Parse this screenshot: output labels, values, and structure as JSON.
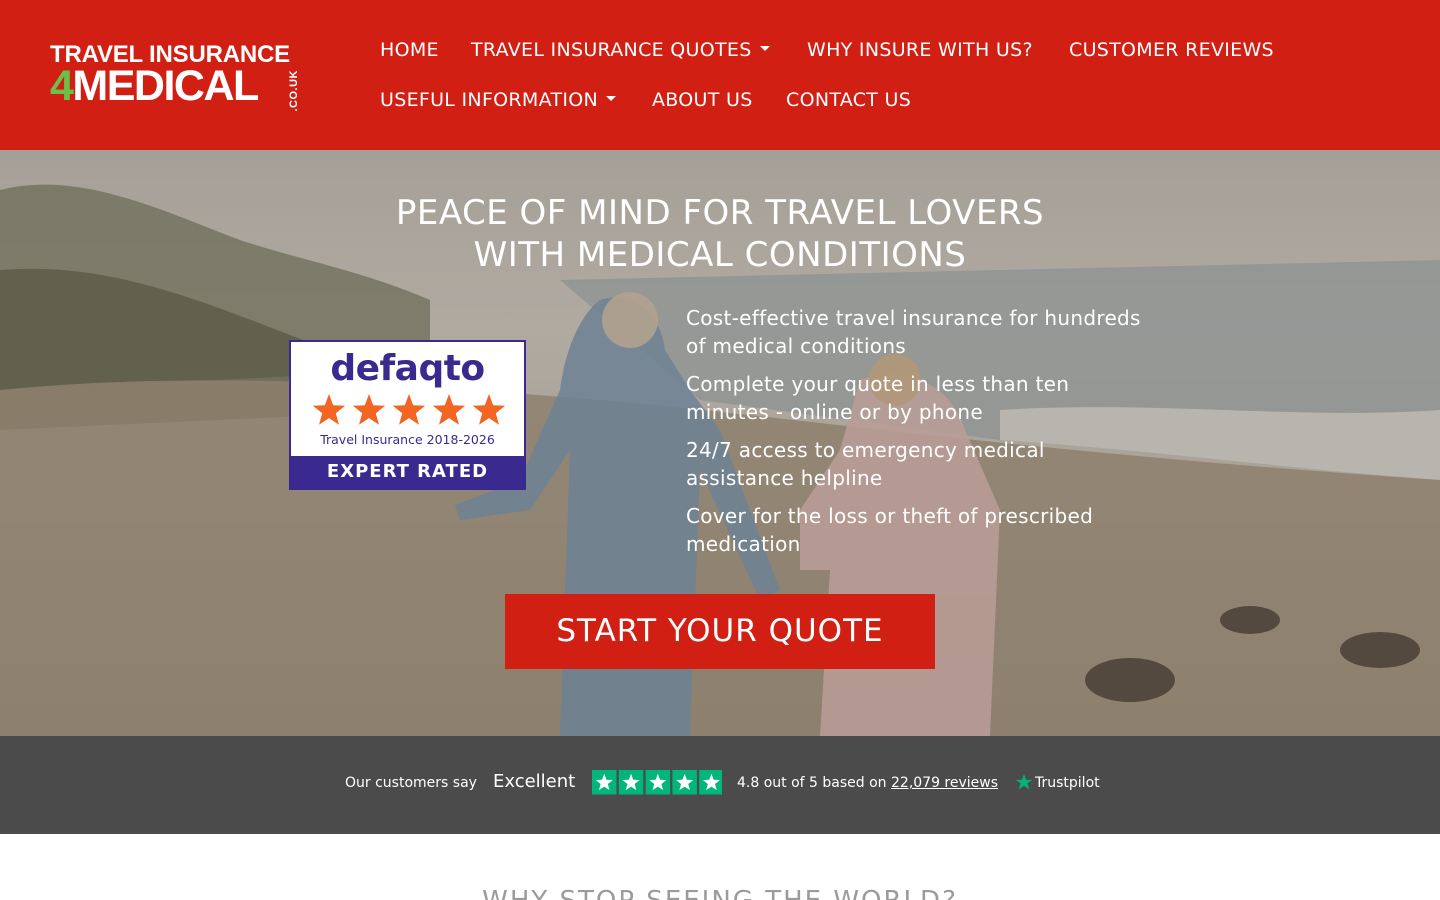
{
  "logo": {
    "line1": "TRAVEL INSURANCE",
    "line2_num": "4",
    "line2_word": "MEDICAL",
    "suffix": ".CO.UK"
  },
  "nav": {
    "home": "HOME",
    "quotes": "TRAVEL INSURANCE QUOTES",
    "why": "WHY INSURE WITH US?",
    "reviews": "CUSTOMER REVIEWS",
    "useful": "USEFUL INFORMATION",
    "about": "ABOUT US",
    "contact": "CONTACT US"
  },
  "hero": {
    "title_line1": "PEACE OF MIND FOR TRAVEL LOVERS",
    "title_line2": "WITH MEDICAL CONDITIONS",
    "benefits": [
      "Cost-effective travel insurance for hundreds of medical conditions",
      "Complete your quote in less than ten minutes - online or by phone",
      "24/7 access to emergency medical assistance helpline",
      "Cover for the loss or theft of prescribed medication"
    ],
    "cta": "START YOUR QUOTE"
  },
  "badge": {
    "brand": "defaqto",
    "stars": 5,
    "subtitle": "Travel Insurance 2018-2026",
    "band": "EXPERT RATED",
    "color": "#3a2a8f",
    "star_color": "#f26522"
  },
  "trustpilot": {
    "intro": "Our customers say",
    "rating_word": "Excellent",
    "stars": 5,
    "score_text": "4.8 out of 5 based on",
    "reviews_link": "22,079 reviews",
    "brand": "Trustpilot",
    "star_color": "#00b67a"
  },
  "next_section": {
    "heading": "WHY STOP SEEING THE WORLD?"
  },
  "colors": {
    "brand_red": "#d21f14",
    "logo_green": "#6cc04a",
    "band_grey": "#4b4b4b"
  }
}
